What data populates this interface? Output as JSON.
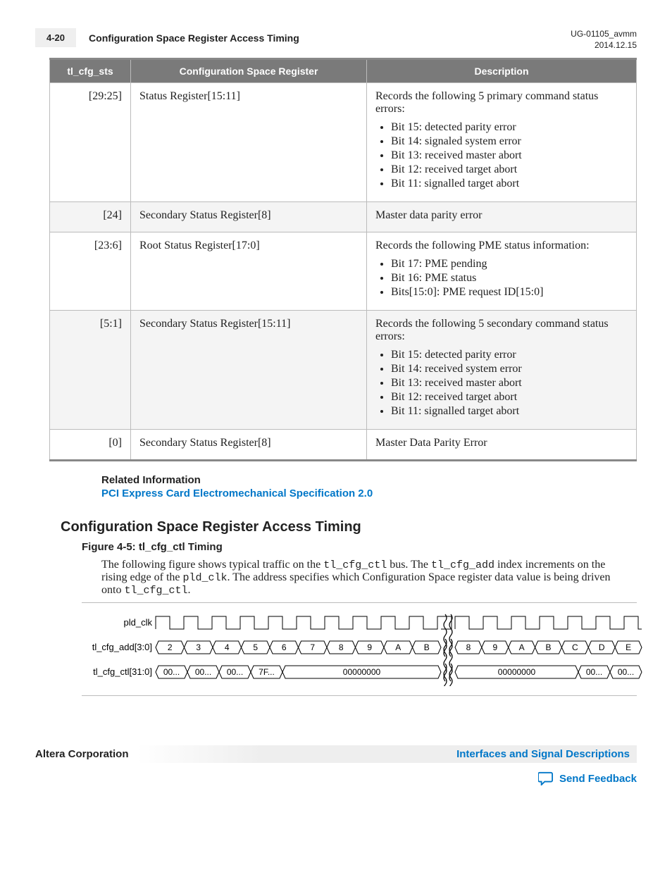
{
  "header": {
    "page_num": "4-20",
    "title": "Configuration Space Register Access Timing",
    "doc_id": "UG-01105_avmm",
    "date": "2014.12.15"
  },
  "table": {
    "headers": {
      "c1": "tl_cfg_sts",
      "c2": "Configuration Space Register",
      "c3": "Description"
    },
    "rows": [
      {
        "bits": "[29:25]",
        "reg": "Status Register[15:11]",
        "desc_intro": "Records the following 5 primary command status errors:",
        "items": [
          "Bit 15: detected parity error",
          "Bit 14: signaled system error",
          "Bit 13: received master abort",
          "Bit 12: received target abort",
          "Bit 11: signalled target abort"
        ]
      },
      {
        "bits": "[24]",
        "reg": "Secondary Status Register[8]",
        "desc_intro": "Master data parity error",
        "items": []
      },
      {
        "bits": "[23:6]",
        "reg": "Root Status Register[17:0]",
        "desc_intro": "Records the following PME status information:",
        "items": [
          "Bit 17: PME pending",
          "Bit 16: PME status",
          "Bits[15:0]: PME request ID[15:0]"
        ]
      },
      {
        "bits": "[5:1]",
        "reg": "Secondary Status Register[15:11]",
        "desc_intro": "Records the following 5 secondary command status errors:",
        "items": [
          "Bit 15: detected parity error",
          "Bit 14: received system error",
          "Bit 13: received master abort",
          "Bit 12: received target abort",
          "Bit 11: signalled target abort"
        ]
      },
      {
        "bits": "[0]",
        "reg": "Secondary Status Register[8]",
        "desc_intro": "Master Data Parity Error",
        "items": []
      }
    ]
  },
  "related": {
    "title": "Related Information",
    "link": "PCI Express Card Electromechanical Specification 2.0"
  },
  "section_heading": "Configuration Space Register Access Timing",
  "figure": {
    "title": "Figure 4-5: tl_cfg_ctl Timing",
    "desc_1": "The following figure shows typical traffic on the ",
    "desc_m1": "tl_cfg_ctl",
    "desc_2": " bus. The ",
    "desc_m2": "tl_cfg_add",
    "desc_3": " index increments on the rising edge of the ",
    "desc_m3": "pld_clk",
    "desc_4": ". The address specifies which Configuration Space register data value is being driven onto ",
    "desc_m4": "tl_cfg_ctl",
    "desc_5": "."
  },
  "timing": {
    "sig1": "pld_clk",
    "sig2": "tl_cfg_add[3:0]",
    "sig3": "tl_cfg_ctl[31:0]",
    "addr_left": [
      "2",
      "3",
      "4",
      "5",
      "6",
      "7",
      "8",
      "9",
      "A",
      "B"
    ],
    "addr_right": [
      "8",
      "9",
      "A",
      "B",
      "C",
      "D",
      "E"
    ],
    "ctl_left": [
      "00...",
      "00...",
      "00...",
      "7F...",
      "00000000"
    ],
    "ctl_right": [
      "00000000",
      "00...",
      "00..."
    ]
  },
  "footer": {
    "corp": "Altera Corporation",
    "chapter": "Interfaces and Signal Descriptions",
    "feedback": "Send Feedback"
  }
}
